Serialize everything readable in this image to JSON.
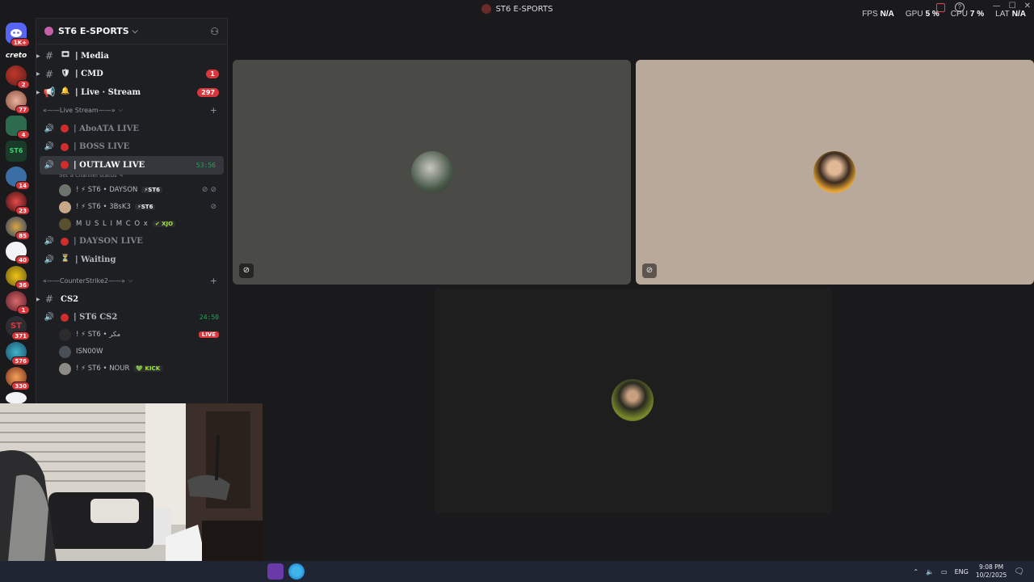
{
  "window": {
    "title": "ST6 E-SPORTS"
  },
  "perf": [
    {
      "label": "FPS",
      "value": "N/A"
    },
    {
      "label": "GPU",
      "value": "5 %"
    },
    {
      "label": "CPU",
      "value": "7 %"
    },
    {
      "label": "LAT",
      "value": "N/A"
    }
  ],
  "rail": {
    "home_badge": "1K+",
    "creto_text": "creto",
    "badges": [
      "2",
      "77",
      "4",
      "14",
      "23",
      "85",
      "40",
      "36",
      "1",
      "371",
      "576",
      "330"
    ]
  },
  "server": {
    "name": "ST6 E-SPORTS",
    "channels_top": [
      {
        "icon": "🎞",
        "name": "| Media",
        "badge": ""
      },
      {
        "icon": "🛡",
        "name": "| CMD",
        "badge": "1"
      },
      {
        "icon": "🔔",
        "name": "| Live · Stream",
        "badge": "297"
      }
    ],
    "category_live": "«——Live Stream——»",
    "voice_live": {
      "aboata": "| AboATA LIVE",
      "boss": "| BOSS LIVE",
      "outlaw": "| OUTLAW LIVE",
      "outlaw_time": "53:56",
      "outlaw_status": "Set a channel status",
      "dayson": "| DAYSON LIVE",
      "waiting": "| Waiting"
    },
    "outlaw_users": [
      {
        "name": "! ⚡ ST6 • DAYSON",
        "tag": "⚡ST6"
      },
      {
        "name": "! ⚡ ST6 • 3BsK3",
        "tag": "⚡ST6"
      },
      {
        "name": "M U S L I M C O x",
        "tag": "✔ XJO"
      }
    ],
    "category_cs": "«——CounterStrike2——»",
    "cs_text": "CS2",
    "cs_voice": "| ST6 CS2",
    "cs_time": "24:50",
    "cs_users": [
      {
        "name": "! ⚡ ST6 • مكر",
        "tag": ""
      },
      {
        "name": "ISN00W",
        "tag": ""
      },
      {
        "name": "! ⚡ ST6 • NOUR",
        "tag": "💚 KICK"
      }
    ],
    "live_label": "LIVE"
  },
  "taskbar": {
    "lang": "ENG",
    "time": "9:08 PM",
    "date": "10/2/2025"
  },
  "colors": {
    "tile1": "#4a4b46",
    "tile2": "#b9a99a",
    "tile3": "#1e1e1e",
    "speaking": "#23a55a",
    "badge": "#da373c"
  }
}
